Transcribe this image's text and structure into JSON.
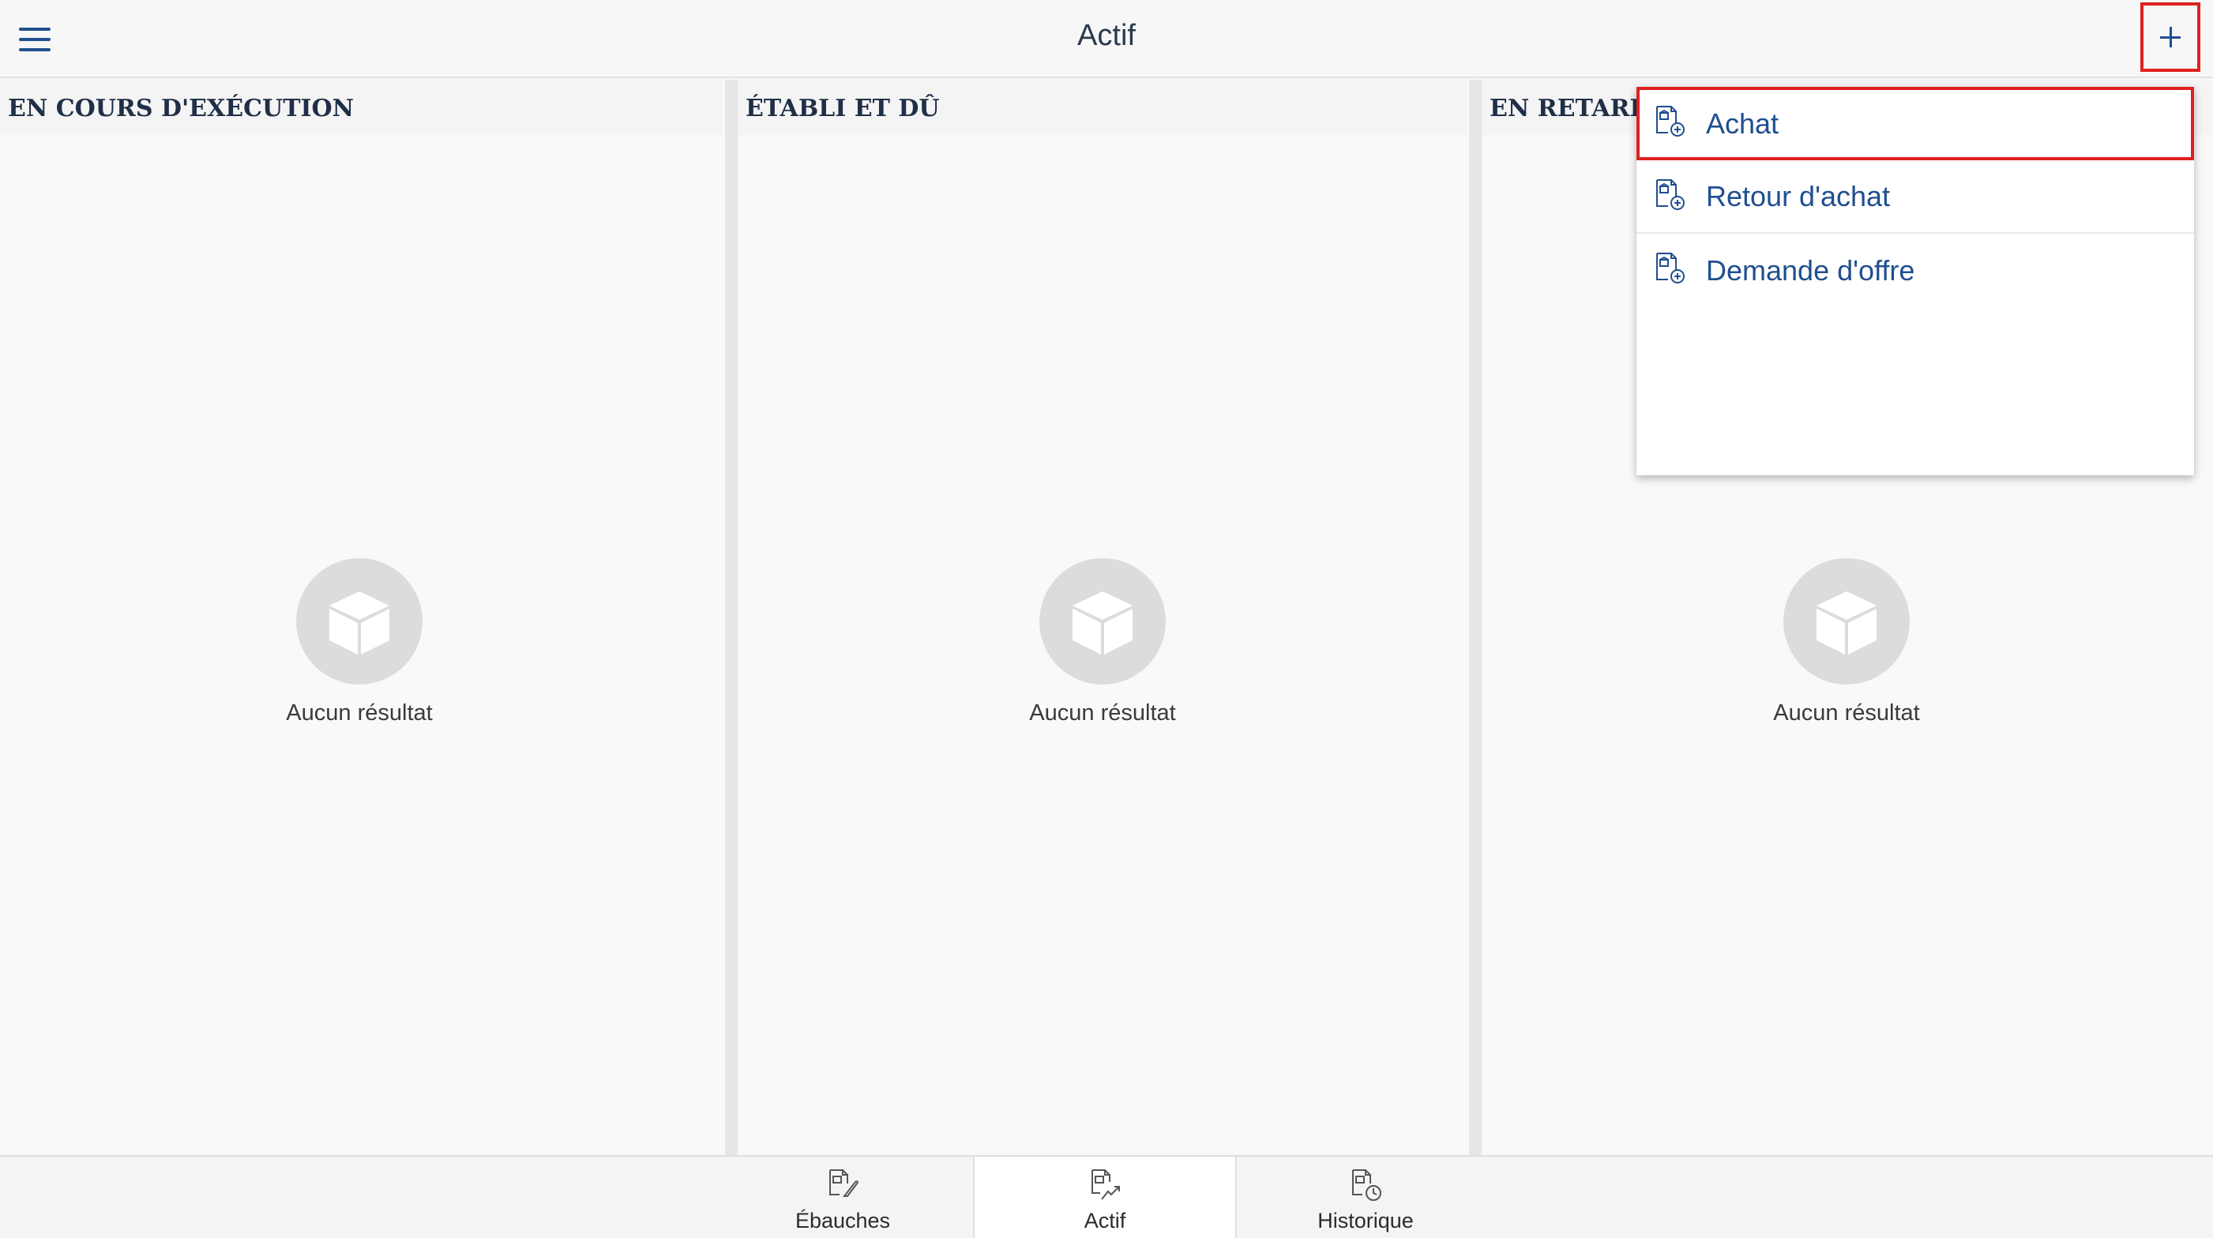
{
  "header": {
    "title": "Actif",
    "menu_icon": "hamburger-icon",
    "add_icon": "plus-icon"
  },
  "columns": [
    {
      "title": "EN COURS D'EXÉCUTION",
      "empty_text": "Aucun résultat"
    },
    {
      "title": "ÉTABLI ET DÛ",
      "empty_text": "Aucun résultat"
    },
    {
      "title": "EN RETARD",
      "empty_text": "Aucun résultat"
    }
  ],
  "dropdown": {
    "items": [
      {
        "label": "Achat",
        "icon": "document-add-icon",
        "selected": true
      },
      {
        "label": "Retour d'achat",
        "icon": "document-add-icon"
      },
      {
        "label": "Demande d'offre",
        "icon": "document-add-icon"
      }
    ]
  },
  "bottom_tabs": [
    {
      "label": "Ébauches",
      "icon": "document-edit-icon"
    },
    {
      "label": "Actif",
      "icon": "document-trend-icon",
      "active": true
    },
    {
      "label": "Historique",
      "icon": "document-history-icon"
    }
  ],
  "colors": {
    "accent": "#1f4f8f",
    "highlight": "#e02020",
    "empty_circle": "#dcdcdc"
  }
}
